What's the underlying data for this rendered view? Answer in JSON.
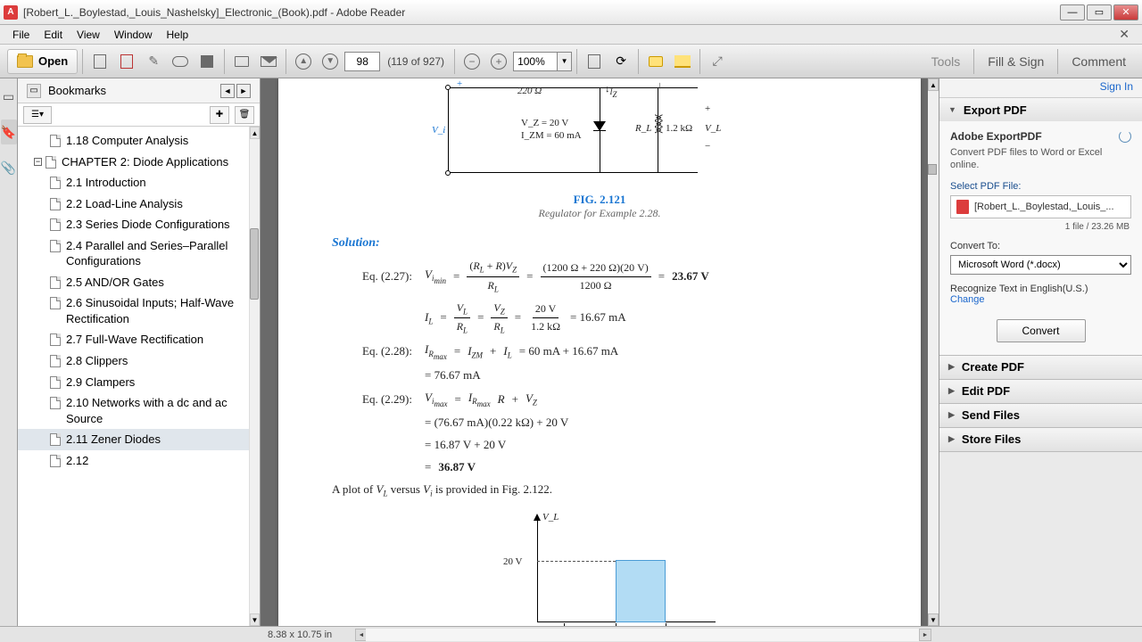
{
  "title": "[Robert_L._Boylestad,_Louis_Nashelsky]_Electronic_(Book).pdf - Adobe Reader",
  "menu": {
    "file": "File",
    "edit": "Edit",
    "view": "View",
    "window": "Window",
    "help": "Help"
  },
  "toolbar": {
    "open": "Open",
    "page_value": "98",
    "page_count": "(119 of 927)",
    "zoom_value": "100%",
    "tools": "Tools",
    "fill_sign": "Fill & Sign",
    "comment": "Comment"
  },
  "signin": "Sign In",
  "bookmarks": {
    "title": "Bookmarks",
    "items": [
      {
        "level": 2,
        "label": "1.18 Computer Analysis"
      },
      {
        "level": 1,
        "label": "CHAPTER 2: Diode Applications",
        "chapter": true
      },
      {
        "level": 2,
        "label": "2.1 Introduction"
      },
      {
        "level": 2,
        "label": "2.2 Load-Line Analysis"
      },
      {
        "level": 2,
        "label": "2.3 Series Diode Configurations"
      },
      {
        "level": 2,
        "label": "2.4 Parallel and Series–Parallel Configurations"
      },
      {
        "level": 2,
        "label": "2.5 AND/OR Gates"
      },
      {
        "level": 2,
        "label": "2.6 Sinusoidal Inputs; Half-Wave Rectification"
      },
      {
        "level": 2,
        "label": "2.7 Full-Wave Rectification"
      },
      {
        "level": 2,
        "label": "2.8 Clippers"
      },
      {
        "level": 2,
        "label": "2.9 Clampers"
      },
      {
        "level": 2,
        "label": "2.10 Networks with a dc and ac Source"
      },
      {
        "level": 2,
        "label": "2.11 Zener Diodes",
        "selected": true
      },
      {
        "level": 2,
        "label": "2.12"
      }
    ]
  },
  "doc": {
    "r_label": "220 Ω",
    "iz_label": "I_Z",
    "vi_label": "V_i",
    "vz": "V_Z = 20 V",
    "izm": "I_ZM = 60 mA",
    "rl": "R_L",
    "rlv": "1.2 kΩ",
    "vl": "V_L",
    "fig_num": "FIG. 2.121",
    "fig_text": "Regulator for Example 2.28.",
    "solution": "Solution:",
    "eq227_label": "Eq. (2.27):",
    "eq227": "V_{i_min} = (R_L + R)V_Z / R_L = (1200 Ω + 220 Ω)(20 V) / 1200 Ω = 23.67 V",
    "il": "I_L = V_L / R_L = V_Z / R_L = 20 V / 1.2 kΩ = 16.67 mA",
    "eq228_label": "Eq. (2.28):",
    "eq228a": "I_{R_max} = I_{ZM} + I_L = 60 mA + 16.67 mA",
    "eq228b": "= 76.67 mA",
    "eq229_label": "Eq. (2.29):",
    "eq229a": "V_{i_max} = I_{R_max} R + V_Z",
    "eq229b": "= (76.67 mA)(0.22 kΩ) + 20 V",
    "eq229c": "= 16.87 V + 20 V",
    "eq229d": "= 36.87 V",
    "plot_text": "A plot of V_L versus V_i is provided in Fig. 2.122.",
    "plot_ylabel": "V_L",
    "plot_ytick": "20 V"
  },
  "right": {
    "export": {
      "title": "Export PDF",
      "brand": "Adobe ExportPDF",
      "desc": "Convert PDF files to Word or Excel online.",
      "select_lbl": "Select PDF File:",
      "file": "[Robert_L._Boylestad,_Louis_...",
      "file_info": "1 file / 23.26 MB",
      "convert_lbl": "Convert To:",
      "convert_opt": "Microsoft Word (*.docx)",
      "recognize": "Recognize Text in English(U.S.)",
      "change": "Change",
      "convert_btn": "Convert"
    },
    "create": "Create PDF",
    "edit": "Edit PDF",
    "send": "Send Files",
    "store": "Store Files"
  },
  "status": {
    "dims": "8.38 x 10.75 in"
  }
}
